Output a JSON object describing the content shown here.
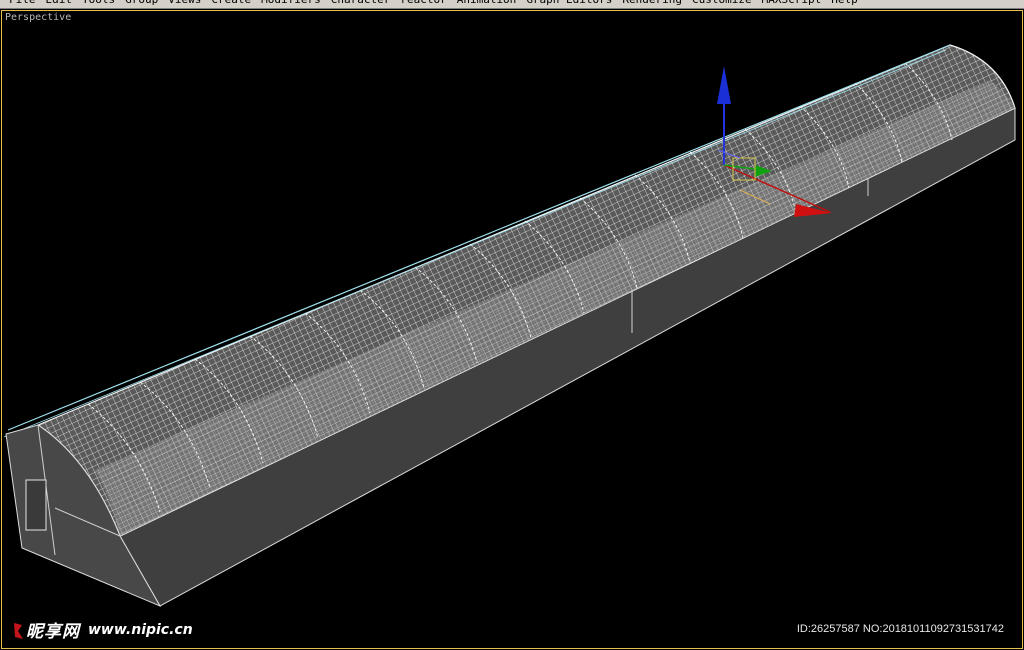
{
  "menubar": {
    "items": [
      "File",
      "Edit",
      "Tools",
      "Group",
      "Views",
      "Create",
      "Modifiers",
      "Character",
      "reactor",
      "Animation",
      "Graph Editors",
      "Rendering",
      "Customize",
      "MAXScript",
      "Help"
    ]
  },
  "viewport": {
    "label": "Perspective",
    "background": "#000000",
    "border_color": "#e6c24a"
  },
  "gizmo": {
    "z_color": "#1a2fd6",
    "x_color": "#d01010",
    "y_color": "#10a010"
  },
  "watermark": {
    "brand_cn": "昵享网",
    "url": "www.nipic.cn",
    "id_text": "ID:26257587 NO:20181011092731531742"
  },
  "icons": {
    "logo": "nipic-logo-icon",
    "gizmo": "transform-gizmo-icon"
  }
}
